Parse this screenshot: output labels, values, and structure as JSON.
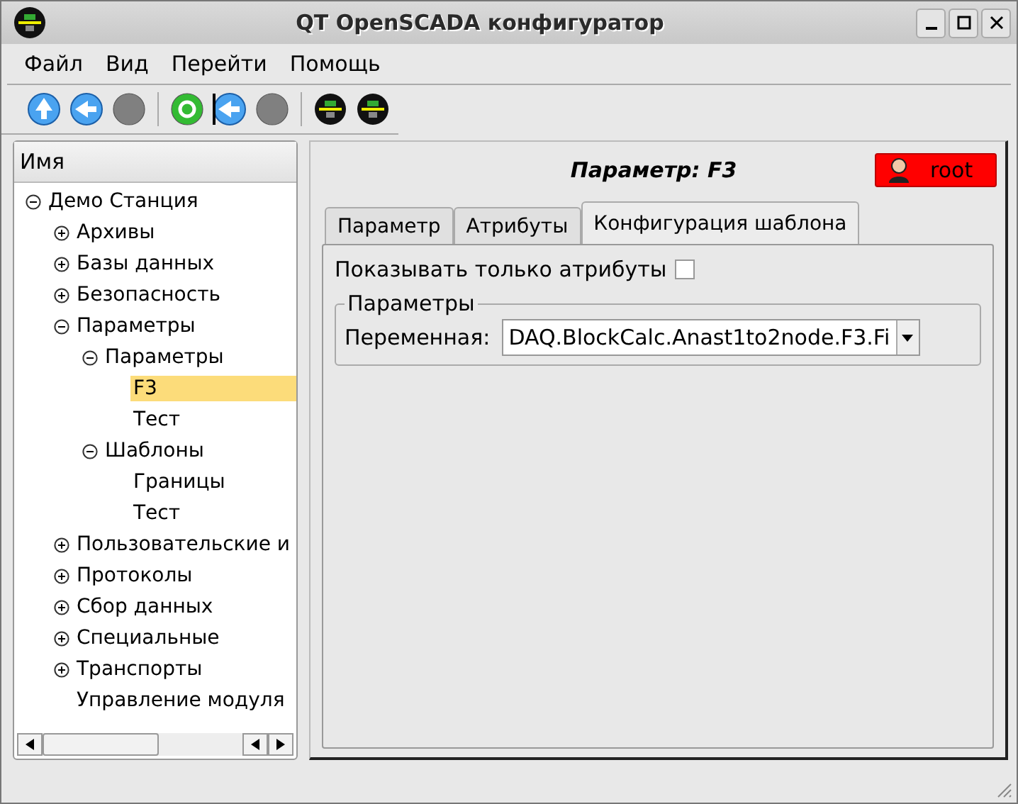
{
  "window": {
    "title": "QT OpenSCADA конфигуратор"
  },
  "menu": [
    {
      "label": "Файл"
    },
    {
      "label": "Вид"
    },
    {
      "label": "Перейти"
    },
    {
      "label": "Помощь"
    }
  ],
  "tree": {
    "header": "Имя",
    "items": [
      {
        "label": "Демо Станция",
        "selected": false,
        "expanded": true,
        "children": [
          {
            "label": "Архивы",
            "selected": false,
            "expanded": false
          },
          {
            "label": "Базы данных",
            "selected": false,
            "expanded": false
          },
          {
            "label": "Безопасность",
            "selected": false,
            "expanded": false
          },
          {
            "label": "Параметры",
            "selected": false,
            "expanded": true,
            "children": [
              {
                "label": "Параметры",
                "selected": false,
                "expanded": true,
                "children": [
                  {
                    "label": "F3",
                    "selected": true
                  },
                  {
                    "label": "Тест",
                    "selected": false
                  }
                ]
              },
              {
                "label": "Шаблоны",
                "selected": false,
                "expanded": true,
                "children": [
                  {
                    "label": "Границы",
                    "selected": false
                  },
                  {
                    "label": "Тест",
                    "selected": false
                  }
                ]
              }
            ]
          },
          {
            "label": "Пользовательские и",
            "selected": false,
            "expanded": false
          },
          {
            "label": "Протоколы",
            "selected": false,
            "expanded": false
          },
          {
            "label": "Сбор данных",
            "selected": false,
            "expanded": false
          },
          {
            "label": "Специальные",
            "selected": false,
            "expanded": false
          },
          {
            "label": "Транспорты",
            "selected": false,
            "expanded": false
          },
          {
            "label": "Управление модуля",
            "selected": false
          }
        ]
      }
    ]
  },
  "page": {
    "title": "Параметр: F3",
    "user": "root",
    "tabs": [
      {
        "label": "Параметр",
        "selected": false
      },
      {
        "label": "Атрибуты",
        "selected": false
      },
      {
        "label": "Конфигурация шаблона",
        "selected": true
      }
    ],
    "show_only_attributes": {
      "label": "Показывать только атрибуты",
      "checked": false
    },
    "group": {
      "title": "Параметры",
      "field_label": "Переменная:",
      "value": "DAQ.BlockCalc.Anast1to2node.F3.Fi"
    }
  }
}
